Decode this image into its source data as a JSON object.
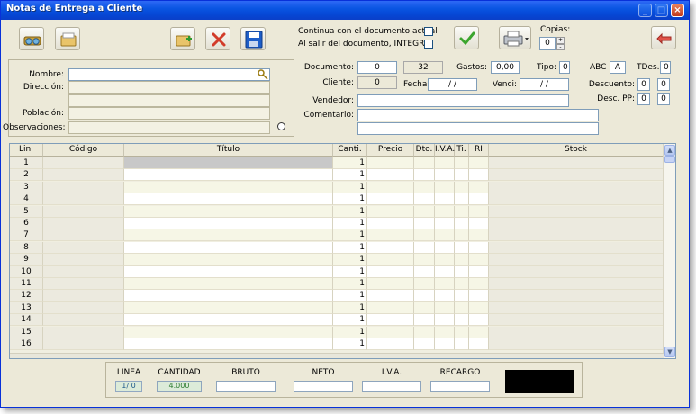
{
  "window": {
    "title": "Notas de Entrega a Cliente"
  },
  "options": {
    "continue_label": "Continua con el documento actual",
    "integra_label": "Al salir del documento, INTEGRA",
    "copies_label": "Copias:",
    "copies_value": "0"
  },
  "client": {
    "name_label": "Nombre:",
    "address_label": "Dirección:",
    "city_label": "Población:",
    "notes_label": "Observaciones:"
  },
  "doc": {
    "document_label": "Documento:",
    "document_value": "0",
    "document_counter": "32",
    "expenses_label": "Gastos:",
    "expenses_value": "0,00",
    "type_label": "Tipo:",
    "type_value": "0",
    "abc_label": "ABC",
    "abc_value": "A",
    "tdes_label": "TDes.",
    "tdes_value": "0",
    "client_label": "Cliente:",
    "client_value": "0",
    "date_label": "Fecha:",
    "date_value": " / /",
    "due_label": "Venci:",
    "due_value": " / /",
    "discount_label": "Descuento:",
    "discount_value_1": "0",
    "discount_value_2": "0",
    "descpp_label": "Desc. PP:",
    "descpp_value_1": "0",
    "descpp_value_2": "0",
    "seller_label": "Vendedor:",
    "comment_label": "Comentario:"
  },
  "grid": {
    "columns": [
      "Lin.",
      "Código",
      "Título",
      "Canti.",
      "Precio",
      "Dto.",
      "I.V.A.",
      "Ti.",
      "RI",
      "Stock"
    ],
    "rows": [
      {
        "lin": "1",
        "qty": "1"
      },
      {
        "lin": "2",
        "qty": "1"
      },
      {
        "lin": "3",
        "qty": "1"
      },
      {
        "lin": "4",
        "qty": "1"
      },
      {
        "lin": "5",
        "qty": "1"
      },
      {
        "lin": "6",
        "qty": "1"
      },
      {
        "lin": "7",
        "qty": "1"
      },
      {
        "lin": "8",
        "qty": "1"
      },
      {
        "lin": "9",
        "qty": "1"
      },
      {
        "lin": "10",
        "qty": "1"
      },
      {
        "lin": "11",
        "qty": "1"
      },
      {
        "lin": "12",
        "qty": "1"
      },
      {
        "lin": "13",
        "qty": "1"
      },
      {
        "lin": "14",
        "qty": "1"
      },
      {
        "lin": "15",
        "qty": "1"
      },
      {
        "lin": "16",
        "qty": "1"
      }
    ]
  },
  "totals": {
    "line_label": "LINEA",
    "line_value": "1/ 0",
    "qty_label": "CANTIDAD",
    "qty_value": "4.000",
    "gross_label": "BRUTO",
    "net_label": "NETO",
    "vat_label": "I.V.A.",
    "surcharge_label": "RECARGO"
  },
  "colors": {
    "titlebar": "#0A55E2",
    "face": "#ECE9D8",
    "total_display": "#000000",
    "ok_green": "#3BA52E",
    "delete_red": "#D23C2B",
    "save_blue": "#1D5EC9"
  }
}
